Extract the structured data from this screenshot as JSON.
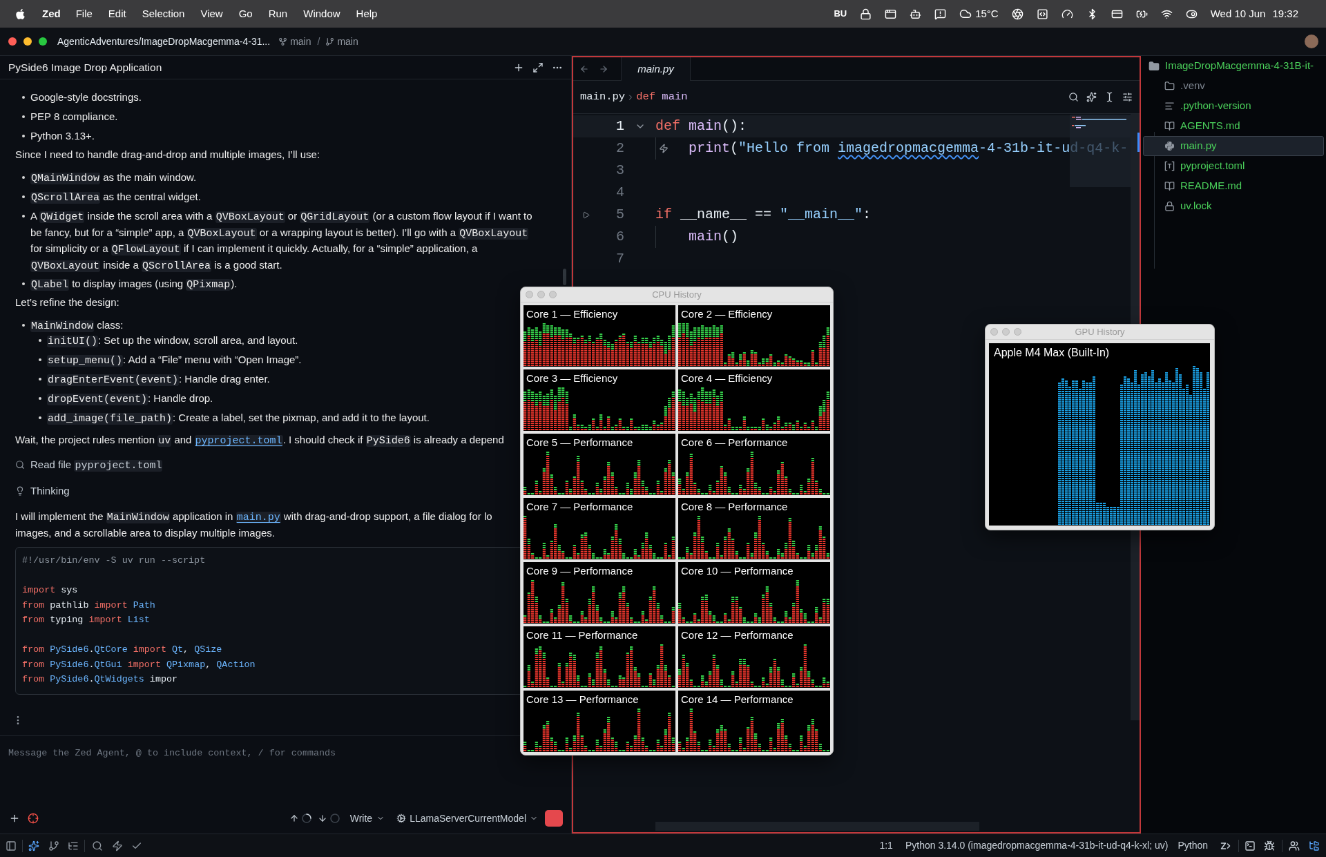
{
  "menu_bar": {
    "app": "Zed",
    "menus": [
      "File",
      "Edit",
      "Selection",
      "View",
      "Go",
      "Run",
      "Window",
      "Help"
    ],
    "input_source": "BU",
    "temperature": "15°C",
    "date": "Wed 10 Jun",
    "time": "19:32"
  },
  "title_bar": {
    "project": "AgenticAdventures/ImageDropMacgemma-4-31...",
    "worktree": "main",
    "separator": "/",
    "branch": "main"
  },
  "agent_panel": {
    "title": "PySide6 Image Drop Application",
    "blocks": [
      {
        "kind": "list",
        "items": [
          {
            "lines": [
              [
                {
                  "kind": "text",
                  "text": "Google-style docstrings."
                }
              ]
            ]
          },
          {
            "lines": [
              [
                {
                  "kind": "text",
                  "text": "PEP 8 compliance."
                }
              ]
            ]
          },
          {
            "lines": [
              [
                {
                  "kind": "text",
                  "text": "Python 3.13+."
                }
              ]
            ]
          }
        ]
      },
      {
        "kind": "paragraph",
        "lines": [
          [
            {
              "kind": "text",
              "text": "Since I need to handle drag-and-drop and multiple images, I’ll use:"
            }
          ]
        ]
      },
      {
        "kind": "list",
        "items": [
          {
            "lines": [
              [
                {
                  "kind": "code",
                  "text": "QMainWindow"
                },
                {
                  "kind": "text",
                  "text": " as the main window."
                }
              ]
            ]
          },
          {
            "lines": [
              [
                {
                  "kind": "code",
                  "text": "QScrollArea"
                },
                {
                  "kind": "text",
                  "text": " as the central widget."
                }
              ]
            ]
          },
          {
            "lines": [
              [
                {
                  "kind": "text",
                  "text": "A "
                },
                {
                  "kind": "code",
                  "text": "QWidget"
                },
                {
                  "kind": "text",
                  "text": " inside the scroll area with a "
                },
                {
                  "kind": "code",
                  "text": "QVBoxLayout"
                },
                {
                  "kind": "text",
                  "text": " or "
                },
                {
                  "kind": "code",
                  "text": "QGridLayout"
                },
                {
                  "kind": "text",
                  "text": " (or a custom flow layout if I want to"
                }
              ],
              [
                {
                  "kind": "text",
                  "text": "be fancy, but for a “simple” app, a "
                },
                {
                  "kind": "code",
                  "text": "QVBoxLayout"
                },
                {
                  "kind": "text",
                  "text": " or a wrapping layout is better). I’ll go with a "
                },
                {
                  "kind": "code",
                  "text": "QVBoxLayout"
                }
              ],
              [
                {
                  "kind": "text",
                  "text": "for simplicity or a "
                },
                {
                  "kind": "code",
                  "text": "QFlowLayout"
                },
                {
                  "kind": "text",
                  "text": " if I can implement it quickly. Actually, for a “simple” application, a"
                }
              ],
              [
                {
                  "kind": "code",
                  "text": "QVBoxLayout"
                },
                {
                  "kind": "text",
                  "text": " inside a "
                },
                {
                  "kind": "code",
                  "text": "QScrollArea"
                },
                {
                  "kind": "text",
                  "text": " is a good start."
                }
              ]
            ]
          },
          {
            "lines": [
              [
                {
                  "kind": "code",
                  "text": "QLabel"
                },
                {
                  "kind": "text",
                  "text": " to display images (using "
                },
                {
                  "kind": "code",
                  "text": "QPixmap"
                },
                {
                  "kind": "text",
                  "text": ")."
                }
              ]
            ]
          }
        ]
      },
      {
        "kind": "paragraph",
        "lines": [
          [
            {
              "kind": "text",
              "text": "Let’s refine the design:"
            }
          ]
        ]
      },
      {
        "kind": "list",
        "items": [
          {
            "lines": [
              [
                {
                  "kind": "code",
                  "text": "MainWindow"
                },
                {
                  "kind": "text",
                  "text": " class:"
                }
              ]
            ],
            "children": [
              {
                "lines": [
                  [
                    {
                      "kind": "code",
                      "text": "initUI()"
                    },
                    {
                      "kind": "text",
                      "text": ": Set up the window, scroll area, and layout."
                    }
                  ]
                ]
              },
              {
                "lines": [
                  [
                    {
                      "kind": "code",
                      "text": "setup_menu()"
                    },
                    {
                      "kind": "text",
                      "text": ": Add a “File” menu with “Open Image”."
                    }
                  ]
                ]
              },
              {
                "lines": [
                  [
                    {
                      "kind": "code",
                      "text": "dragEnterEvent(event)"
                    },
                    {
                      "kind": "text",
                      "text": ": Handle drag enter."
                    }
                  ]
                ]
              },
              {
                "lines": [
                  [
                    {
                      "kind": "code",
                      "text": "dropEvent(event)"
                    },
                    {
                      "kind": "text",
                      "text": ": Handle drop."
                    }
                  ]
                ]
              },
              {
                "lines": [
                  [
                    {
                      "kind": "code",
                      "text": "add_image(file_path)"
                    },
                    {
                      "kind": "text",
                      "text": ": Create a label, set the pixmap, and add it to the layout."
                    }
                  ]
                ]
              }
            ]
          }
        ]
      },
      {
        "kind": "paragraph",
        "lines": [
          [
            {
              "kind": "text",
              "text": "Wait, the project rules mention "
            },
            {
              "kind": "code",
              "text": "uv"
            },
            {
              "kind": "text",
              "text": " and "
            },
            {
              "kind": "link",
              "text": "pyproject.toml"
            },
            {
              "kind": "text",
              "text": ". I should check if "
            },
            {
              "kind": "code",
              "text": "PySide6"
            },
            {
              "kind": "text",
              "text": " is already a depend"
            }
          ]
        ]
      },
      {
        "kind": "tool_call",
        "label": "Read file",
        "target": "pyproject.toml"
      },
      {
        "kind": "thinking",
        "label": "Thinking"
      },
      {
        "kind": "paragraph",
        "lines": [
          [
            {
              "kind": "text",
              "text": "I will implement the "
            },
            {
              "kind": "code",
              "text": "MainWindow"
            },
            {
              "kind": "text",
              "text": " application in "
            },
            {
              "kind": "link",
              "text": "main.py"
            },
            {
              "kind": "text",
              "text": " with drag-and-drop support, a file dialog for lo"
            }
          ],
          [
            {
              "kind": "text",
              "text": "images, and a scrollable area to display multiple images."
            }
          ]
        ]
      },
      {
        "kind": "code_block",
        "sections": [
          [
            [
              {
                "kind": "comment",
                "text": "#!/usr/bin/env -S uv run --script"
              }
            ]
          ],
          [
            [
              {
                "kind": "keyword",
                "text": "import"
              },
              {
                "kind": "plain",
                "text": " sys"
              }
            ],
            [
              {
                "kind": "keyword",
                "text": "from"
              },
              {
                "kind": "plain",
                "text": " pathlib "
              },
              {
                "kind": "keyword",
                "text": "import"
              },
              {
                "kind": "type",
                "text": " Path"
              }
            ],
            [
              {
                "kind": "keyword",
                "text": "from"
              },
              {
                "kind": "plain",
                "text": " typing "
              },
              {
                "kind": "keyword",
                "text": "import"
              },
              {
                "kind": "type",
                "text": " List"
              }
            ]
          ],
          [
            [
              {
                "kind": "keyword",
                "text": "from"
              },
              {
                "kind": "type",
                "text": " PySide6"
              },
              {
                "kind": "plain",
                "text": "."
              },
              {
                "kind": "type",
                "text": "QtCore"
              },
              {
                "kind": "keyword",
                "text": " import"
              },
              {
                "kind": "type",
                "text": " Qt"
              },
              {
                "kind": "plain",
                "text": ", "
              },
              {
                "kind": "type",
                "text": "QSize"
              }
            ],
            [
              {
                "kind": "keyword",
                "text": "from"
              },
              {
                "kind": "type",
                "text": " PySide6"
              },
              {
                "kind": "plain",
                "text": "."
              },
              {
                "kind": "type",
                "text": "QtGui"
              },
              {
                "kind": "keyword",
                "text": " import"
              },
              {
                "kind": "type",
                "text": " QPixmap"
              },
              {
                "kind": "plain",
                "text": ", "
              },
              {
                "kind": "type",
                "text": "QAction"
              }
            ],
            [
              {
                "kind": "keyword",
                "text": "from"
              },
              {
                "kind": "type",
                "text": " PySide6"
              },
              {
                "kind": "plain",
                "text": "."
              },
              {
                "kind": "type",
                "text": "QtWidgets"
              },
              {
                "kind": "plain",
                "text": " impor"
              }
            ]
          ]
        ]
      }
    ],
    "placeholder": "Message the Zed Agent, @ to include context, / for commands",
    "mode": "Write",
    "model": "LLamaServerCurrentModel"
  },
  "editor": {
    "tabs": [
      {
        "label": "main.py",
        "selected": true,
        "preview": true
      }
    ],
    "breadcrumb": {
      "file": "main.py",
      "keyword": "def",
      "symbol": "main"
    },
    "lines": [
      {
        "number": "1",
        "current": true,
        "kind": "fold",
        "tokens": [
          {
            "kind": "keyword",
            "text": "def"
          },
          {
            "kind": "function",
            "text": " main"
          },
          {
            "kind": "plain",
            "text": "():"
          }
        ],
        "children": [
          {
            "number": "2",
            "current": false,
            "kind": "action",
            "tokens": [
              {
                "kind": "function",
                "text": "print"
              },
              {
                "kind": "plain",
                "text": "("
              },
              {
                "kind": "string",
                "text": "\"Hello from "
              },
              {
                "kind": "misspelled",
                "text": "imagedropmacgemma"
              },
              {
                "kind": "string",
                "text": "-4-31b-it-ud-q4-k-"
              }
            ]
          }
        ]
      },
      {
        "number": "3",
        "current": false,
        "kind": "plain"
      },
      {
        "number": "4",
        "current": false,
        "kind": "plain"
      },
      {
        "number": "5",
        "current": false,
        "kind": "run",
        "tokens": [
          {
            "kind": "keyword",
            "text": "if"
          },
          {
            "kind": "plain",
            "text": " __name__ == "
          },
          {
            "kind": "string",
            "text": "\"__main__\""
          },
          {
            "kind": "plain",
            "text": ":"
          }
        ],
        "children": [
          {
            "number": "6",
            "current": false,
            "kind": "plain",
            "tokens": [
              {
                "kind": "function",
                "text": "main"
              },
              {
                "kind": "plain",
                "text": "()"
              }
            ]
          }
        ]
      },
      {
        "number": "7",
        "current": false,
        "kind": "plain"
      }
    ]
  },
  "project_panel": {
    "root": "ImageDropMacgemma-4-31B-it-",
    "items": [
      {
        "name": ".venv",
        "kind": "folder",
        "color": "#7d8590",
        "selected": false
      },
      {
        "name": ".python-version",
        "kind": "text",
        "color": "#4bd05b",
        "selected": false
      },
      {
        "name": "AGENTS.md",
        "kind": "markdown",
        "color": "#4bd05b",
        "selected": false
      },
      {
        "name": "main.py",
        "kind": "python",
        "color": "#4bd05b",
        "selected": true
      },
      {
        "name": "pyproject.toml",
        "kind": "toml",
        "color": "#4bd05b",
        "selected": false
      },
      {
        "name": "README.md",
        "kind": "markdown",
        "color": "#4bd05b",
        "selected": false
      },
      {
        "name": "uv.lock",
        "kind": "lock",
        "color": "#4bd05b",
        "selected": false
      }
    ]
  },
  "cpu_history": {
    "title": "CPU History",
    "cores": [
      "Core 1 — Efficiency",
      "Core 2 — Efficiency",
      "Core 3 — Efficiency",
      "Core 4 — Efficiency",
      "Core 5 — Performance",
      "Core 6 — Performance",
      "Core 7 — Performance",
      "Core 8 — Performance",
      "Core 9 — Performance",
      "Core 10 — Performance",
      "Core 11 — Performance",
      "Core 12 — Performance",
      "Core 13 — Performance",
      "Core 14 — Performance"
    ]
  },
  "gpu_history": {
    "title": "GPU History",
    "gpu": "Apple M4 Max (Built-In)"
  },
  "status_bar": {
    "left_tools": [
      {
        "selected": false
      },
      {
        "selected": true
      },
      {
        "selected": false
      },
      {
        "selected": false
      },
      {
        "selected": false
      },
      {
        "selected": false
      },
      {
        "selected": false
      }
    ],
    "cursor": "1:1",
    "toolchain": "Python 3.14.0 (imagedropmacgemma-4-31b-it-ud-q4-k-xl; uv)",
    "language": "Python",
    "right_tools": [
      {
        "selected": false
      },
      {
        "selected": false
      },
      {
        "selected": false
      },
      {
        "selected": false
      },
      {
        "selected": true
      }
    ]
  }
}
